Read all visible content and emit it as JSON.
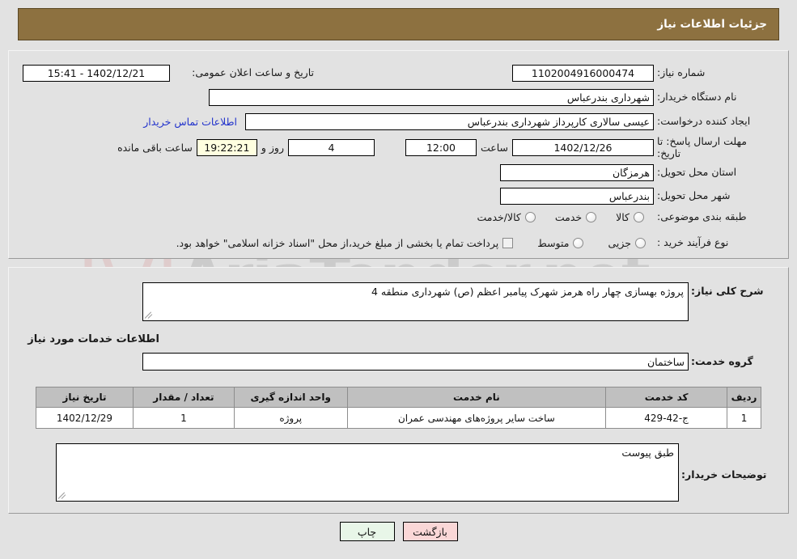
{
  "window": {
    "title": "جزئیات اطلاعات نیاز"
  },
  "watermark": {
    "text": "AriaTender.net",
    "logo_icon": "shield-w-icon"
  },
  "colors": {
    "header_bar": "#8d7140",
    "page_background": "#e2e2e2",
    "table_header": "#c0c0c0",
    "link": "#2233cc",
    "countdown_field": "#ffffe0",
    "print_button": "#e8f6e8",
    "back_button": "#fad7d7"
  },
  "top_panel": {
    "need_number": {
      "label": "شماره نیاز:",
      "value": "1102004916000474"
    },
    "public_announcement": {
      "label": "تاریخ و ساعت اعلان عمومی:",
      "value": "15:41 - 1402/12/21"
    },
    "buyer_org": {
      "label": "نام دستگاه خریدار:",
      "value": "شهرداری بندرعباس"
    },
    "request_creator": {
      "label": "ایجاد کننده درخواست:",
      "value": "عیسی سالاری کارپرداز شهرداری بندرعباس"
    },
    "buyer_contact_link": "اطلاعات تماس خریدار",
    "response_deadline": {
      "label": "مهلت ارسال پاسخ: تا تاریخ:",
      "date": "1402/12/26",
      "time_label": "ساعت",
      "time": "12:00",
      "days_remaining": "4",
      "days_separator": "روز و",
      "clock_remaining": "19:22:21",
      "remaining_suffix": "ساعت باقی مانده"
    },
    "delivery_province": {
      "label": "استان محل تحویل:",
      "value": "هرمزگان"
    },
    "delivery_city": {
      "label": "شهر محل تحویل:",
      "value": "بندرعباس"
    },
    "subject_classification": {
      "label": "طبقه بندی موضوعی:",
      "options": [
        {
          "caption": "کالا",
          "selected": false
        },
        {
          "caption": "خدمت",
          "selected": false
        },
        {
          "caption": "کالا/خدمت",
          "selected": false
        }
      ]
    },
    "purchase_process": {
      "label": "نوع فرآیند خرید :",
      "options": [
        {
          "caption": "جزیی",
          "selected": false
        },
        {
          "caption": "متوسط",
          "selected": false
        }
      ],
      "treasury_note": {
        "checked": false,
        "text": "پرداخت تمام یا بخشی از مبلغ خرید،از محل \"اسناد خزانه اسلامی\" خواهد بود."
      }
    }
  },
  "bottom_panel": {
    "general_description": {
      "label": "شرح کلی نیاز:",
      "value": "پروژه بهسازی چهار راه هرمز شهرک پیامبر اعظم (ص) شهرداری منطقه 4"
    },
    "services_section_title": "اطلاعات خدمات مورد نیاز",
    "service_group": {
      "label": "گروه خدمت:",
      "value": "ساختمان"
    },
    "items_table": {
      "headers": [
        "ردیف",
        "کد خدمت",
        "نام خدمت",
        "واحد اندازه گیری",
        "تعداد / مقدار",
        "تاریخ نیاز"
      ],
      "rows": [
        {
          "row_no": "1",
          "service_code": "ج-42-429",
          "service_name": "ساخت سایر پروژه‌های مهندسی عمران",
          "unit": "پروژه",
          "quantity": "1",
          "need_date": "1402/12/29"
        }
      ]
    },
    "buyer_notes": {
      "label": "توضیحات خریدار:",
      "value": "طبق پیوست"
    }
  },
  "footer": {
    "print_button": "چاپ",
    "back_button": "بازگشت"
  }
}
